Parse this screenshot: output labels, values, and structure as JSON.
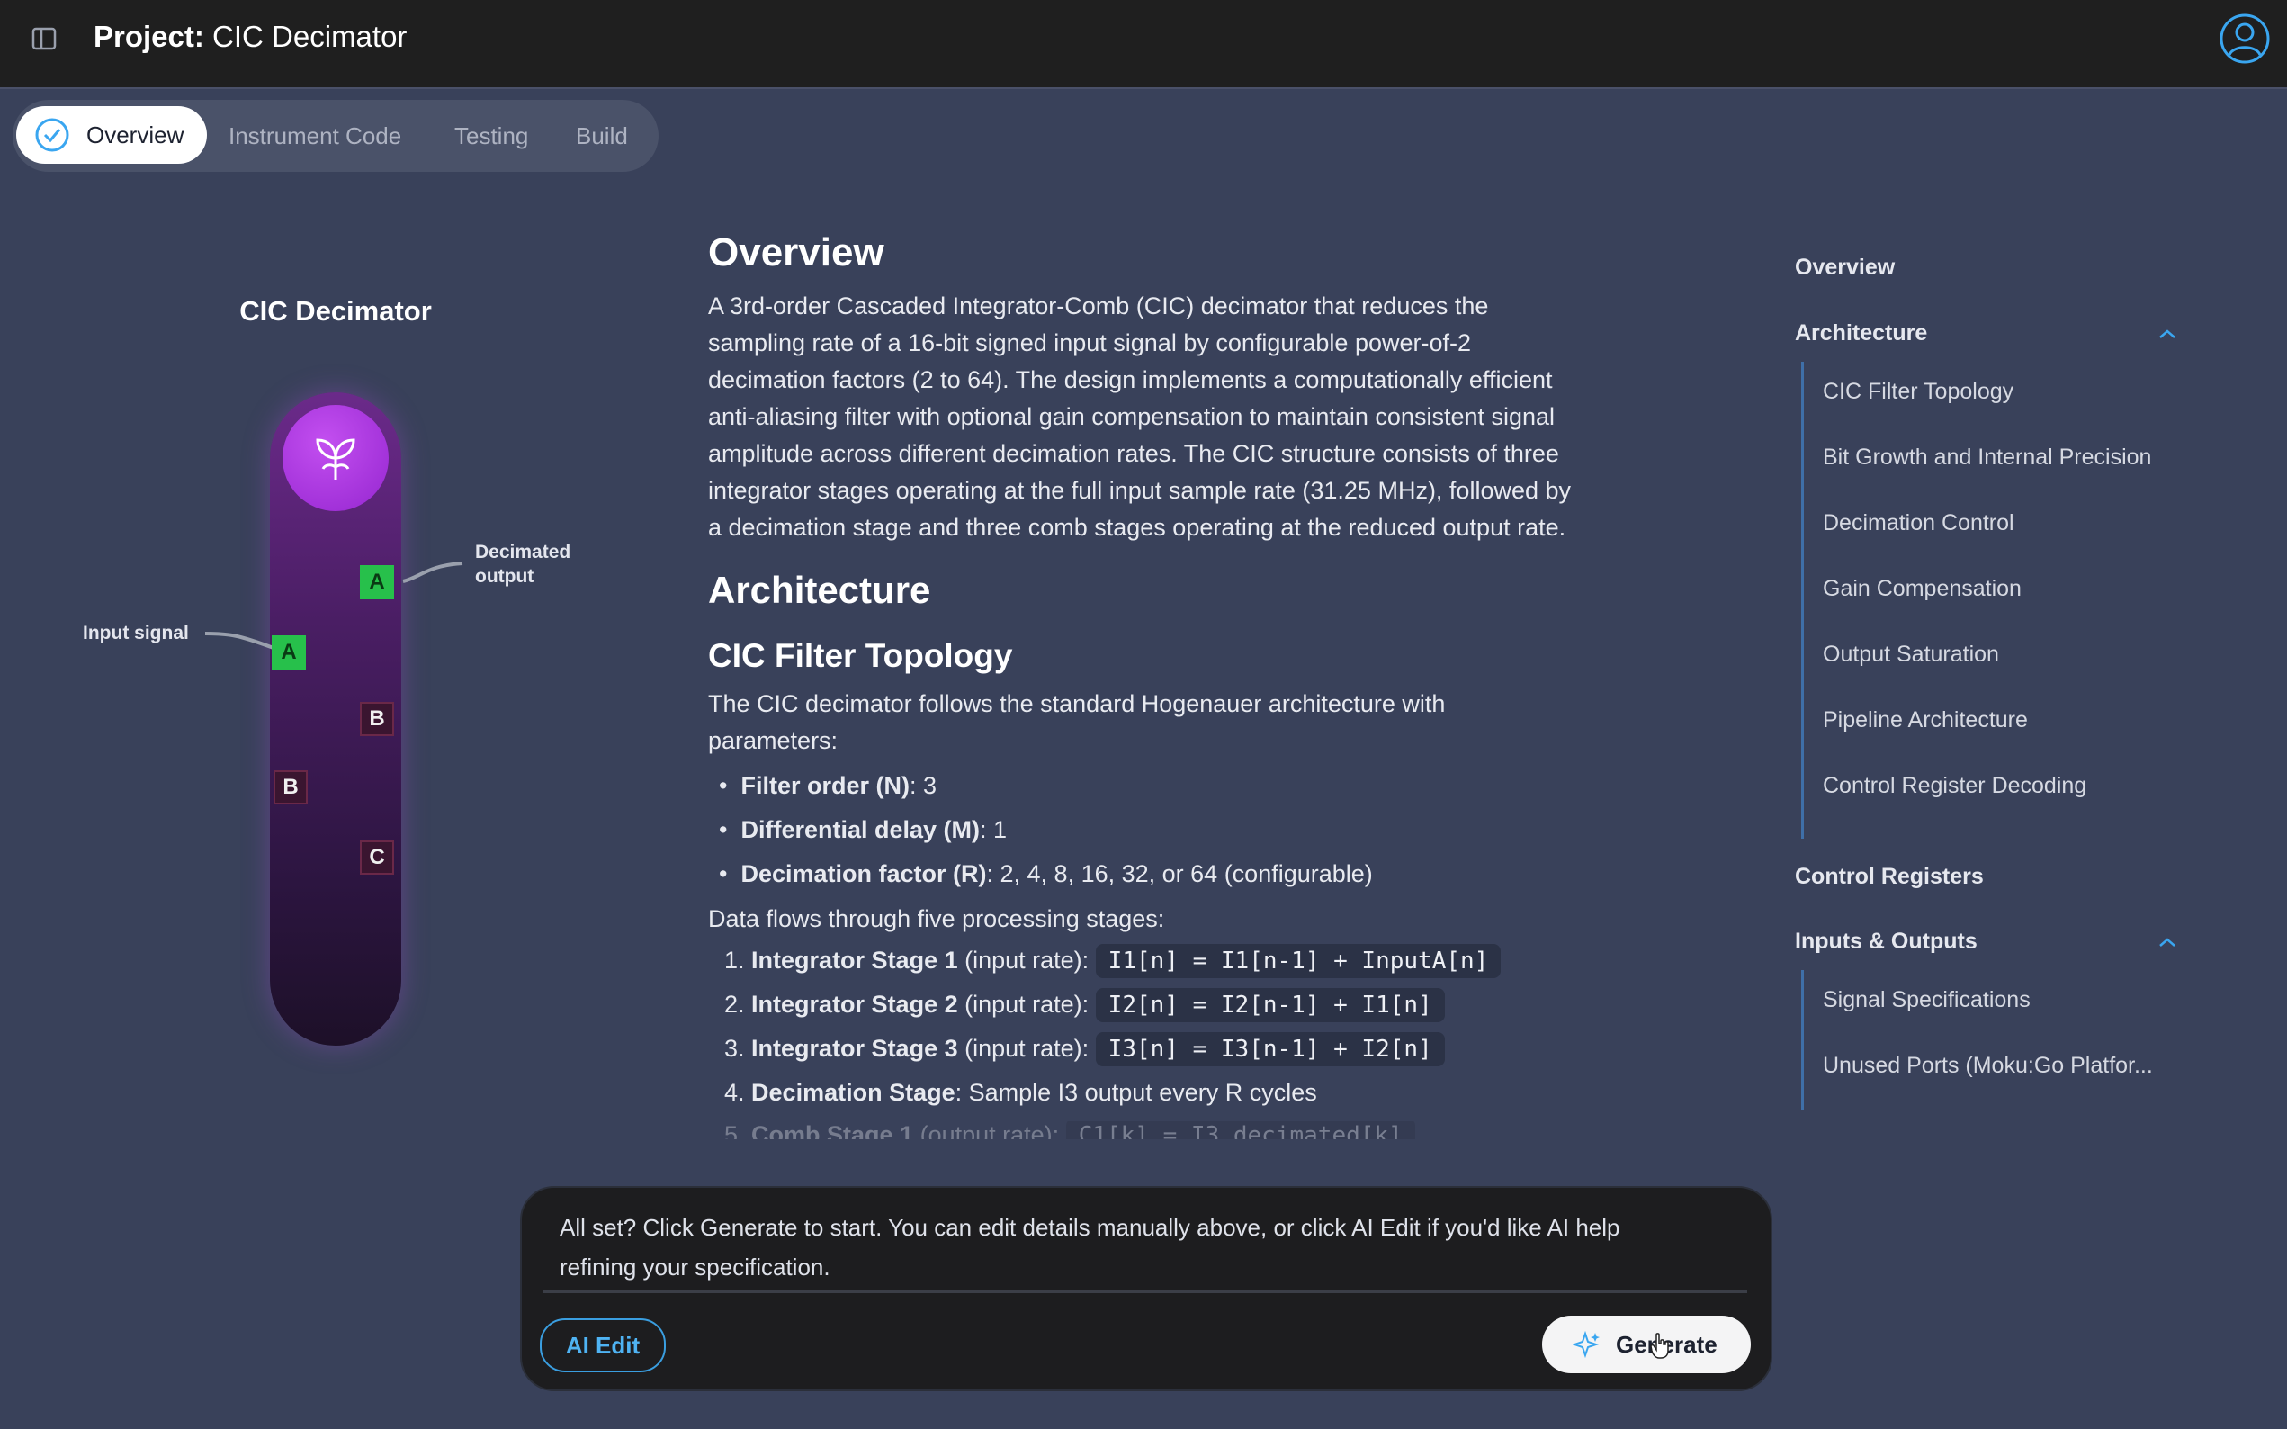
{
  "header": {
    "project_prefix": "Project:",
    "project_name": "CIC Decimator"
  },
  "tabs": [
    {
      "label": "Overview",
      "active": true
    },
    {
      "label": "Instrument Code"
    },
    {
      "label": "Testing"
    },
    {
      "label": "Build"
    }
  ],
  "diagram": {
    "title": "CIC Decimator",
    "input_label": "Input signal",
    "output_label_line1": "Decimated",
    "output_label_line2": "output",
    "ports": [
      "A",
      "A",
      "B",
      "B",
      "C"
    ]
  },
  "content": {
    "overview_heading": "Overview",
    "overview_lines": [
      "A 3rd-order Cascaded Integrator-Comb (CIC) decimator that reduces the",
      "sampling rate of a 16-bit signed input signal by configurable power-of-2",
      "decimation factors (2 to 64). The design implements a computationally efficient",
      "anti-aliasing filter with optional gain compensation to maintain consistent signal",
      "amplitude across different decimation rates. The CIC structure consists of three",
      "integrator stages operating at the full input sample rate (31.25 MHz), followed by",
      "a decimation stage and three comb stages operating at the reduced output rate."
    ],
    "architecture_heading": "Architecture",
    "topology_heading": "CIC Filter Topology",
    "topology_lines": [
      "The CIC decimator follows the standard Hogenauer architecture with",
      "parameters:"
    ],
    "bullets": [
      {
        "label": "Filter order (N)",
        "value": ": 3"
      },
      {
        "label": "Differential delay (M)",
        "value": ": 1"
      },
      {
        "label": "Decimation factor (R)",
        "value": ": 2, 4, 8, 16, 32, or 64 (configurable)"
      }
    ],
    "flow_intro": "Data flows through five processing stages:",
    "stages": [
      {
        "num": "1.",
        "label": "Integrator Stage 1",
        "rest": " (input rate): ",
        "code": "I1[n] = I1[n-1] + InputA[n]"
      },
      {
        "num": "2.",
        "label": "Integrator Stage 2",
        "rest": " (input rate): ",
        "code": "I2[n] = I2[n-1] + I1[n]"
      },
      {
        "num": "3.",
        "label": "Integrator Stage 3",
        "rest": " (input rate): ",
        "code": "I3[n] = I3[n-1] + I2[n]"
      },
      {
        "num": "4.",
        "label": "Decimation Stage",
        "rest": ": Sample I3 output every R cycles",
        "code": ""
      },
      {
        "num": "5.",
        "label": "Comb Stage 1",
        "rest": " (output rate): ",
        "code": "C1[k] = I3_decimated[k]"
      }
    ]
  },
  "toc": {
    "overview": "Overview",
    "architecture": "Architecture",
    "architecture_items": [
      "CIC Filter Topology",
      "Bit Growth and Internal Precision",
      "Decimation Control",
      "Gain Compensation",
      "Output Saturation",
      "Pipeline Architecture",
      "Control Register Decoding"
    ],
    "control_registers": "Control Registers",
    "inputs_outputs": "Inputs & Outputs",
    "io_items": [
      "Signal Specifications",
      "Unused Ports (Moku:Go Platfor..."
    ]
  },
  "prompt": {
    "message_line1": "All set? Click Generate to start. You can edit details manually above, or click AI Edit if you'd like AI help",
    "message_line2": "refining your specification.",
    "ai_edit_label": "AI Edit",
    "generate_label": "Generate"
  },
  "colors": {
    "background": "#39415a",
    "topbar": "#1f1f1f",
    "accent": "#3a9ee0",
    "port_green": "#27c04b",
    "pill_purple": "#6b2a8a"
  }
}
